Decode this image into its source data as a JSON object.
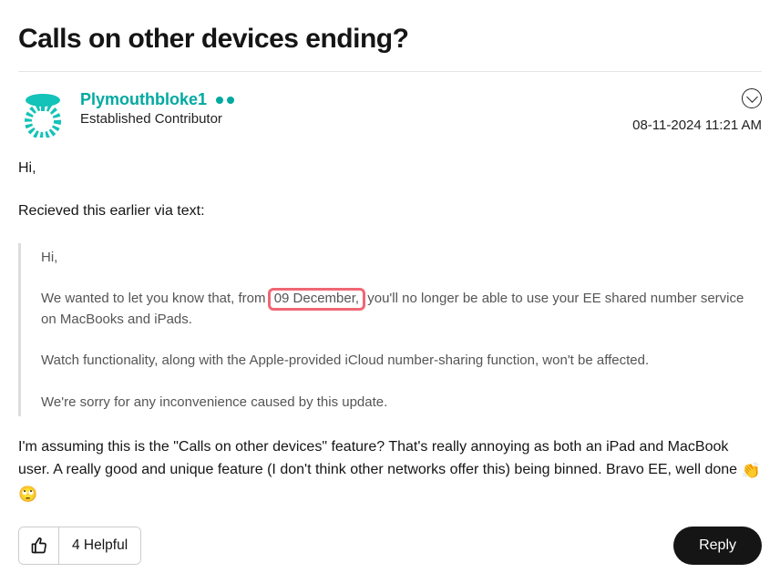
{
  "post": {
    "title": "Calls on other devices ending?",
    "author": {
      "name": "Plymouthbloke1",
      "role": "Established Contributor"
    },
    "date": "‎08-11-2024",
    "time": "11:21 AM",
    "body": {
      "p1": "Hi,",
      "p2": "Recieved this earlier via text:",
      "quote": {
        "q1": "Hi,",
        "q2a": "We wanted to let you know that, from ",
        "q2_highlight": "09 December,",
        "q2b": " you'll no longer be able to use your EE shared number service on MacBooks and iPads.",
        "q3": "Watch functionality, along with the Apple-provided iCloud number-sharing function, won't be affected.",
        "q4": "We're sorry for any inconvenience caused by this update."
      },
      "p3a": "I'm assuming this is the \"Calls on other devices\" feature? That's really annoying as both an iPad and MacBook user. A really good and unique feature (I don't think other networks offer this) being binned. Bravo EE, well done ",
      "p3_emoji": "👏 🙄"
    }
  },
  "actions": {
    "helpful_label": "4 Helpful",
    "reply_label": "Reply"
  }
}
